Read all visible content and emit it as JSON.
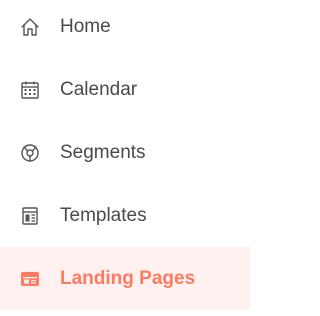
{
  "nav": {
    "items": [
      {
        "label": "Home",
        "icon": "home-icon",
        "active": false
      },
      {
        "label": "Calendar",
        "icon": "calendar-icon",
        "active": false
      },
      {
        "label": "Segments",
        "icon": "segments-icon",
        "active": false
      },
      {
        "label": "Templates",
        "icon": "templates-icon",
        "active": false
      },
      {
        "label": "Landing Pages",
        "icon": "landing-page-icon",
        "active": true
      }
    ]
  },
  "colors": {
    "text": "#4a4a4a",
    "active_text": "#ff7a61",
    "active_background": "#fff1f0",
    "icon": "#555555"
  }
}
